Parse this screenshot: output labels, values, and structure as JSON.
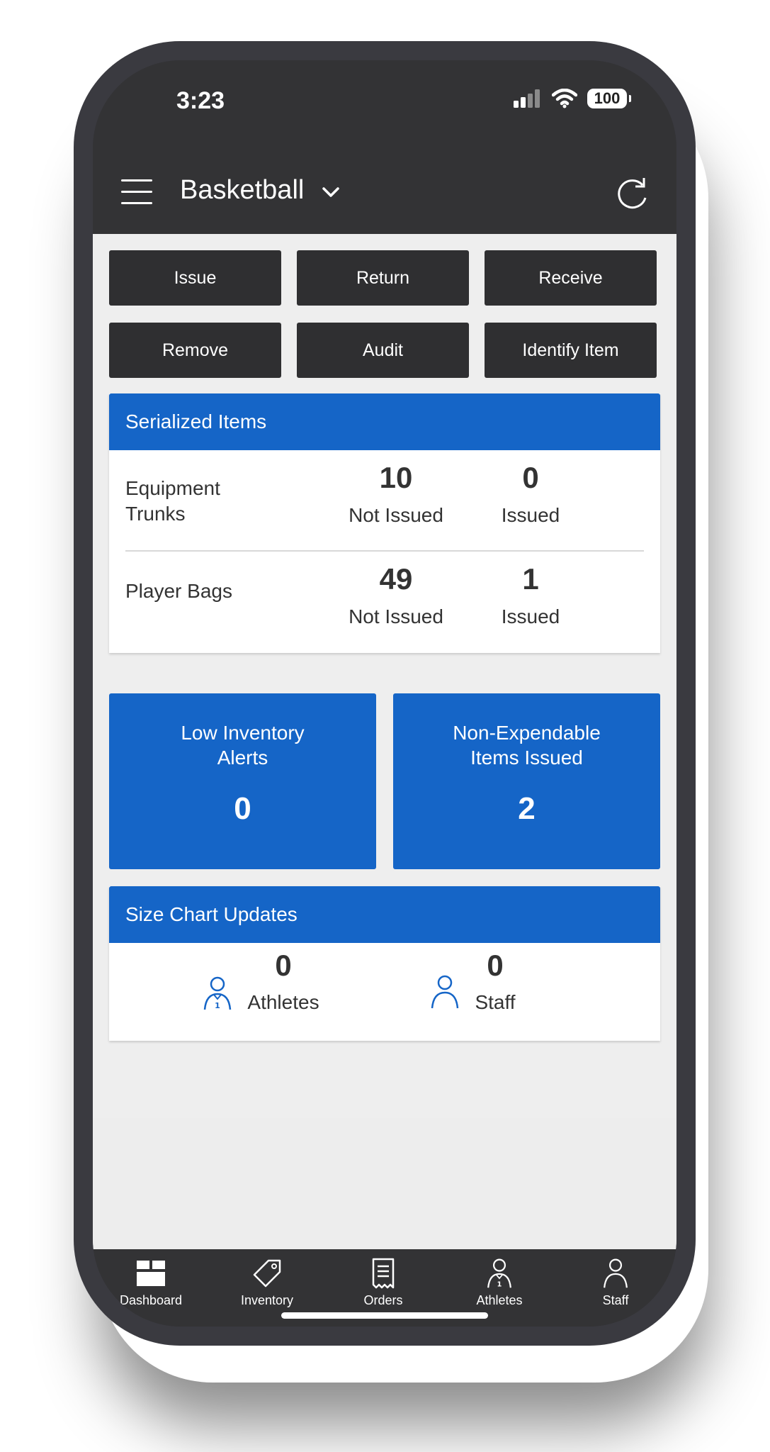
{
  "status_bar": {
    "time": "3:23",
    "battery": "100"
  },
  "header": {
    "title": "Basketball"
  },
  "actions": {
    "issue": "Issue",
    "return": "Return",
    "receive": "Receive",
    "remove": "Remove",
    "audit": "Audit",
    "identify": "Identify Item"
  },
  "serialized": {
    "title": "Serialized Items",
    "rows": [
      {
        "label_line1": "Equipment",
        "label_line2": "Trunks",
        "not_issued": "10",
        "not_issued_label": "Not Issued",
        "issued": "0",
        "issued_label": "Issued"
      },
      {
        "label": "Player Bags",
        "not_issued": "49",
        "not_issued_label": "Not Issued",
        "issued": "1",
        "issued_label": "Issued"
      }
    ]
  },
  "tiles": {
    "low_inventory": {
      "line1": "Low Inventory",
      "line2": "Alerts",
      "value": "0"
    },
    "non_expendable": {
      "line1": "Non-Expendable",
      "line2": "Items Issued",
      "value": "2"
    }
  },
  "size_chart": {
    "title": "Size Chart Updates",
    "athletes_count": "0",
    "athletes_label": "Athletes",
    "staff_count": "0",
    "staff_label": "Staff"
  },
  "tabs": [
    {
      "label": "Dashboard",
      "icon": "dashboard-icon"
    },
    {
      "label": "Inventory",
      "icon": "tag-icon"
    },
    {
      "label": "Orders",
      "icon": "receipt-icon"
    },
    {
      "label": "Athletes",
      "icon": "athlete-icon"
    },
    {
      "label": "Staff",
      "icon": "person-icon"
    }
  ],
  "colors": {
    "primary_blue": "#1565c7",
    "dark": "#333335",
    "button_dark": "#2f2f31",
    "background": "#eeeeee"
  }
}
